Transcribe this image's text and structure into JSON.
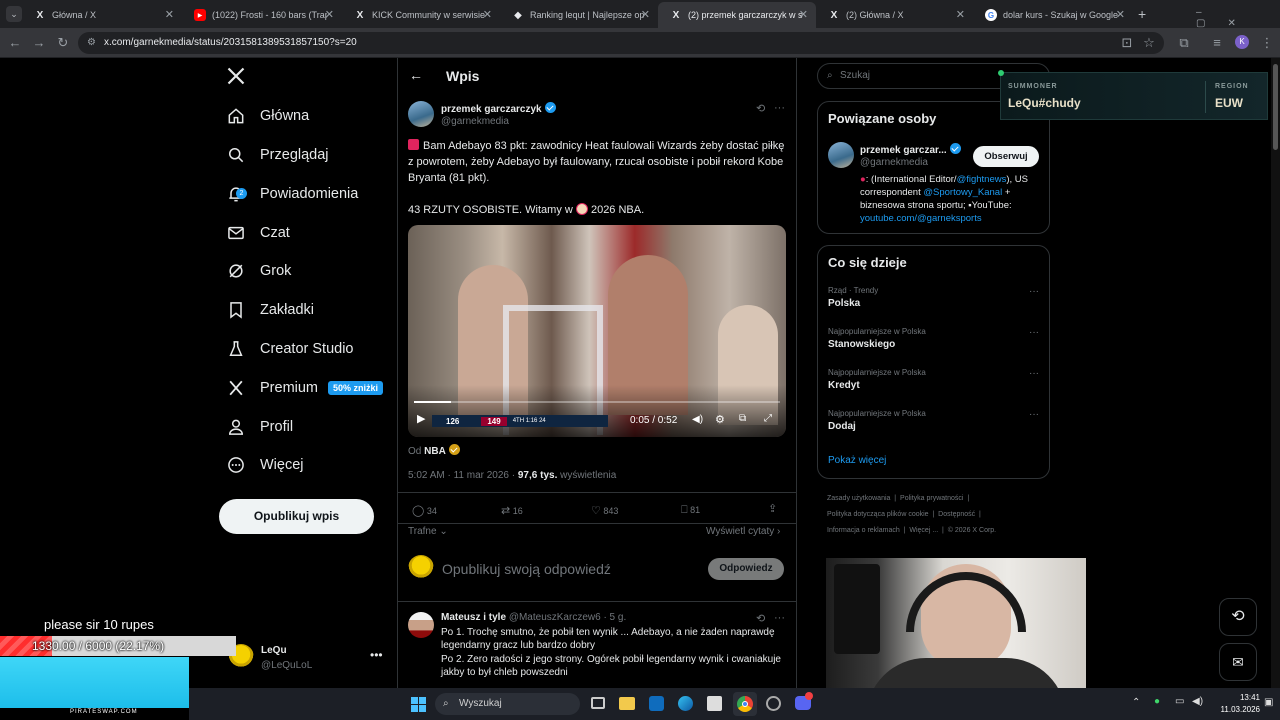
{
  "browser": {
    "tabs": [
      {
        "title": "Główna / X",
        "icon": "X",
        "active": false
      },
      {
        "title": "(1022) Frosti - 160 bars (Trap&)",
        "icon": "▶",
        "active": false
      },
      {
        "title": "KICK Community w serwisie X",
        "icon": "X",
        "active": false
      },
      {
        "title": "Ranking lequt | Najlepsze oprog",
        "icon": "◆",
        "active": false
      },
      {
        "title": "(2) przemek garczarczyk w serw",
        "icon": "X",
        "active": true
      },
      {
        "title": "(2) Główna / X",
        "icon": "X",
        "active": false
      },
      {
        "title": "dolar kurs - Szukaj w Google",
        "icon": "G",
        "active": false
      }
    ],
    "url": "x.com/garnekmedia/status/2031581389531857150?s=20"
  },
  "sidebar": {
    "items": [
      {
        "label": "Główna",
        "icon": "home-icon"
      },
      {
        "label": "Przeglądaj",
        "icon": "search-icon"
      },
      {
        "label": "Powiadomienia",
        "icon": "bell-icon",
        "badge": "2"
      },
      {
        "label": "Czat",
        "icon": "mail-icon"
      },
      {
        "label": "Grok",
        "icon": "grok-icon"
      },
      {
        "label": "Zakładki",
        "icon": "bookmark-icon"
      },
      {
        "label": "Creator Studio",
        "icon": "flask-icon"
      },
      {
        "label": "Premium",
        "icon": "x-icon",
        "promo": "50% zniżki"
      },
      {
        "label": "Profil",
        "icon": "person-icon"
      },
      {
        "label": "Więcej",
        "icon": "more-circle-icon"
      }
    ],
    "post_button": "Opublikuj wpis",
    "account": {
      "name": "LeQu",
      "handle": "@LeQuLoL"
    }
  },
  "main": {
    "header_title": "Wpis",
    "tweet": {
      "author": "przemek garczarczyk",
      "handle": "@garnekmedia",
      "text1": "Bam Adebayo 83 pkt: zawodnicy Heat faulowali Wizards żeby dostać piłkę z powrotem, żeby Adebayo był faulowany, rzucał osobiste i pobił rekord Kobe Bryanta (81 pkt).",
      "text2_a": "43 RZUTY OSOBISTE.  Witamy w",
      "text2_b": "2026 NBA.",
      "video_time": "0:05 / 0:52",
      "score_left": "126",
      "score_right": "149",
      "score_quarter": "4TH 1:16 24",
      "source_prefix": "Od",
      "source": "NBA",
      "meta_time": "5:02 AM · 11 mar 2026 ·",
      "views": "97,6 tys.",
      "views_label": "wyświetlenia",
      "replies": "34",
      "reposts": "16",
      "likes": "843",
      "bookmarks": "81",
      "sort_label": "Trafne",
      "quotes_label": "Wyświetl cytaty"
    },
    "reply_placeholder": "Opublikuj swoją odpowiedź",
    "reply_button": "Odpowiedz",
    "comment": {
      "author": "Mateusz i tyle",
      "handle": "@MateuszKarczew6 · 5 g.",
      "line1": "Po 1. Trochę smutno, że pobił ten wynik ... Adebayo, a nie żaden naprawdę legendarny gracz lub bardzo dobry",
      "line2": "Po 2. Zero radości z jego strony. Ogórek pobił legendarny wynik i cwaniakuje jakby to był chleb powszedni"
    }
  },
  "right": {
    "search_placeholder": "Szukaj",
    "related_title": "Powiązane osoby",
    "related": {
      "name": "przemek garczar...",
      "handle": "@garnekmedia",
      "follow": "Obserwuj",
      "bio_a": ": (International Editor/",
      "bio_link1": "@fightnews",
      "bio_b": "), US correspondent",
      "bio_link2": "@Sportowy_Kanal",
      "bio_c": "+ biznesowa strona sportu;",
      "bio_d": "YouTube:",
      "bio_link3": "youtube.com/@garneksports"
    },
    "trends_title": "Co się dzieje",
    "trends": [
      {
        "context": "Rząd · Trendy",
        "name": "Polska"
      },
      {
        "context": "Najpopularniejsze w Polska",
        "name": "Stanowskiego"
      },
      {
        "context": "Najpopularniejsze w Polska",
        "name": "Kredyt"
      },
      {
        "context": "Najpopularniejsze w Polska",
        "name": "Dodaj"
      }
    ],
    "show_more": "Pokaż więcej",
    "footer": [
      "Zasady użytkowania",
      "Polityka prywatności",
      "Polityka dotycząca plików cookie",
      "Dostępność",
      "Informacja o reklamach",
      "Więcej ...",
      "© 2026 X Corp."
    ]
  },
  "overlay": {
    "summoner_label": "SUMMONER",
    "summoner": "LeQu#chudy",
    "region_label": "REGION",
    "region": "EUW",
    "donation_text": "please sir 10 rupes",
    "progress_text": "1330.00 / 6000 (22.17%)",
    "progress_fraction": 0.2217,
    "ad_text": "PIRATESWAP.COM"
  },
  "taskbar": {
    "search": "Wyszukaj",
    "time": "13:41",
    "date": "11.03.2026"
  }
}
